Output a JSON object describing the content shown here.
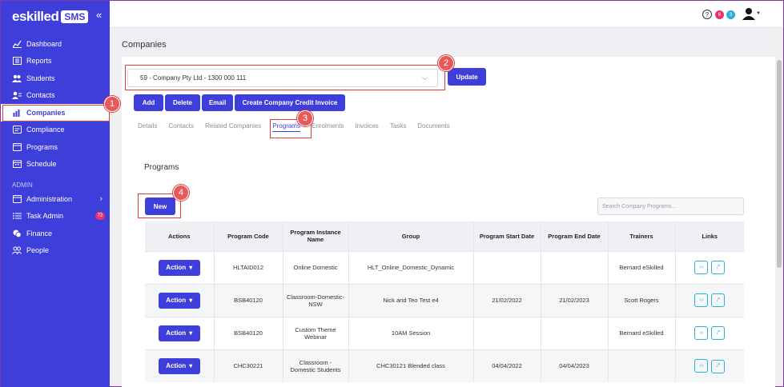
{
  "logo": {
    "text": "eskilled",
    "badge": "SMS"
  },
  "sidebar": {
    "items": [
      {
        "label": "Dashboard",
        "icon": "chart-icon"
      },
      {
        "label": "Reports",
        "icon": "report-icon"
      },
      {
        "label": "Students",
        "icon": "users-icon"
      },
      {
        "label": "Contacts",
        "icon": "contacts-icon"
      },
      {
        "label": "Companies",
        "icon": "building-icon"
      },
      {
        "label": "Compliance",
        "icon": "compliance-icon"
      },
      {
        "label": "Programs",
        "icon": "programs-icon"
      },
      {
        "label": "Schedule",
        "icon": "calendar-icon"
      }
    ],
    "admin_title": "ADMIN",
    "admin_items": [
      {
        "label": "Administration"
      },
      {
        "label": "Task Admin",
        "count": "72"
      },
      {
        "label": "Finance"
      },
      {
        "label": "People"
      }
    ]
  },
  "topbar": {
    "badge_red": "6",
    "badge_blue": "3",
    "help": "?"
  },
  "page": {
    "title": "Companies"
  },
  "company_select": {
    "value": "59 - Company Pty Ltd - 1300 000 111"
  },
  "buttons": {
    "update": "Update",
    "add": "Add",
    "delete": "Delete",
    "email": "Email",
    "credit": "Create Company Credit Invoice",
    "new": "New"
  },
  "tabs": [
    "Details",
    "Contacts",
    "Related Companies",
    "Programs",
    "Enrolments",
    "Invoices",
    "Tasks",
    "Documents"
  ],
  "programs": {
    "title": "Programs",
    "search_placeholder": "Search Company Programs...",
    "columns": [
      "Actions",
      "Program Code",
      "Program Instance Name",
      "Group",
      "Program Start Date",
      "Program End Date",
      "Trainers",
      "Links"
    ],
    "action_label": "Action",
    "rows": [
      {
        "code": "HLTAID012",
        "name": "Online Domestic",
        "group": "HLT_Online_Domestic_Dynamic",
        "start": "",
        "end": "",
        "trainer": "Bernard eSkilled"
      },
      {
        "code": "BSB40120",
        "name": "Classroom-Domestic-NSW",
        "group": "Nick and Teo Test e4",
        "start": "21/02/2022",
        "end": "21/02/2023",
        "trainer": "Scott Rogers"
      },
      {
        "code": "BSB40120",
        "name": "Custom Theme Webinar",
        "group": "10AM Session",
        "start": "",
        "end": "",
        "trainer": "Bernard eSkilled"
      },
      {
        "code": "CHC30221",
        "name": "Classroom - Domestic Students",
        "group": "CHC30121 Blended class",
        "start": "04/04/2022",
        "end": "04/04/2023",
        "trainer": ""
      }
    ]
  },
  "callouts": [
    "1",
    "2",
    "3",
    "4"
  ]
}
